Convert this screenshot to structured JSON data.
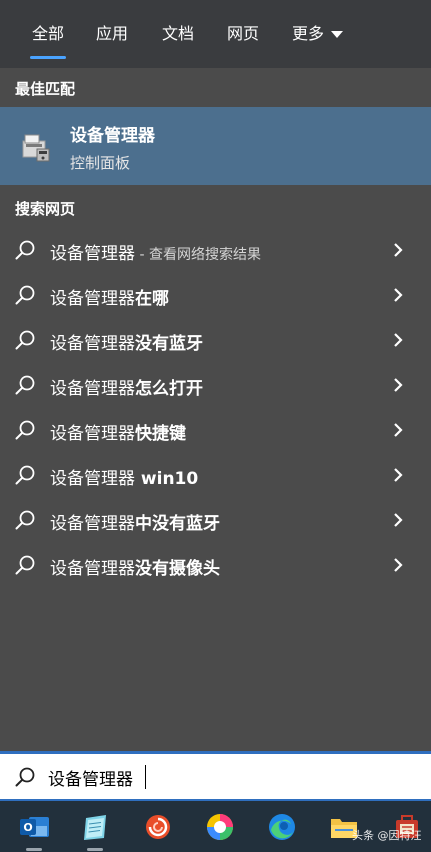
{
  "tabs": [
    "全部",
    "应用",
    "文档",
    "网页",
    "更多"
  ],
  "sections": {
    "best_match": "最佳匹配",
    "web_search": "搜索网页"
  },
  "best_match": {
    "title": "设备管理器",
    "subtitle": "控制面板",
    "icon": "device-manager-icon"
  },
  "results": [
    {
      "base": "设备管理器",
      "bold": "",
      "hint": " - 查看网络搜索结果"
    },
    {
      "base": "设备管理器",
      "bold": "在哪",
      "hint": ""
    },
    {
      "base": "设备管理器",
      "bold": "没有蓝牙",
      "hint": ""
    },
    {
      "base": "设备管理器",
      "bold": "怎么打开",
      "hint": ""
    },
    {
      "base": "设备管理器",
      "bold": "快捷键",
      "hint": ""
    },
    {
      "base": "设备管理器",
      "bold": " win10",
      "hint": ""
    },
    {
      "base": "设备管理器",
      "bold": "中没有蓝牙",
      "hint": ""
    },
    {
      "base": "设备管理器",
      "bold": "没有摄像头",
      "hint": ""
    }
  ],
  "search": {
    "value": "设备管理器"
  },
  "taskbar": [
    "outlook-icon",
    "notepad-icon",
    "swirl-app-icon",
    "color-wheel-icon",
    "edge-icon",
    "file-explorer-icon",
    "toolbox-icon"
  ],
  "watermark": "头条 @因特汪",
  "colors": {
    "accent": "#4aa3ff",
    "selected_bg": "#4c6f8e",
    "panel_bg": "#4b4b4b",
    "taskbar_bg": "#22303c"
  }
}
